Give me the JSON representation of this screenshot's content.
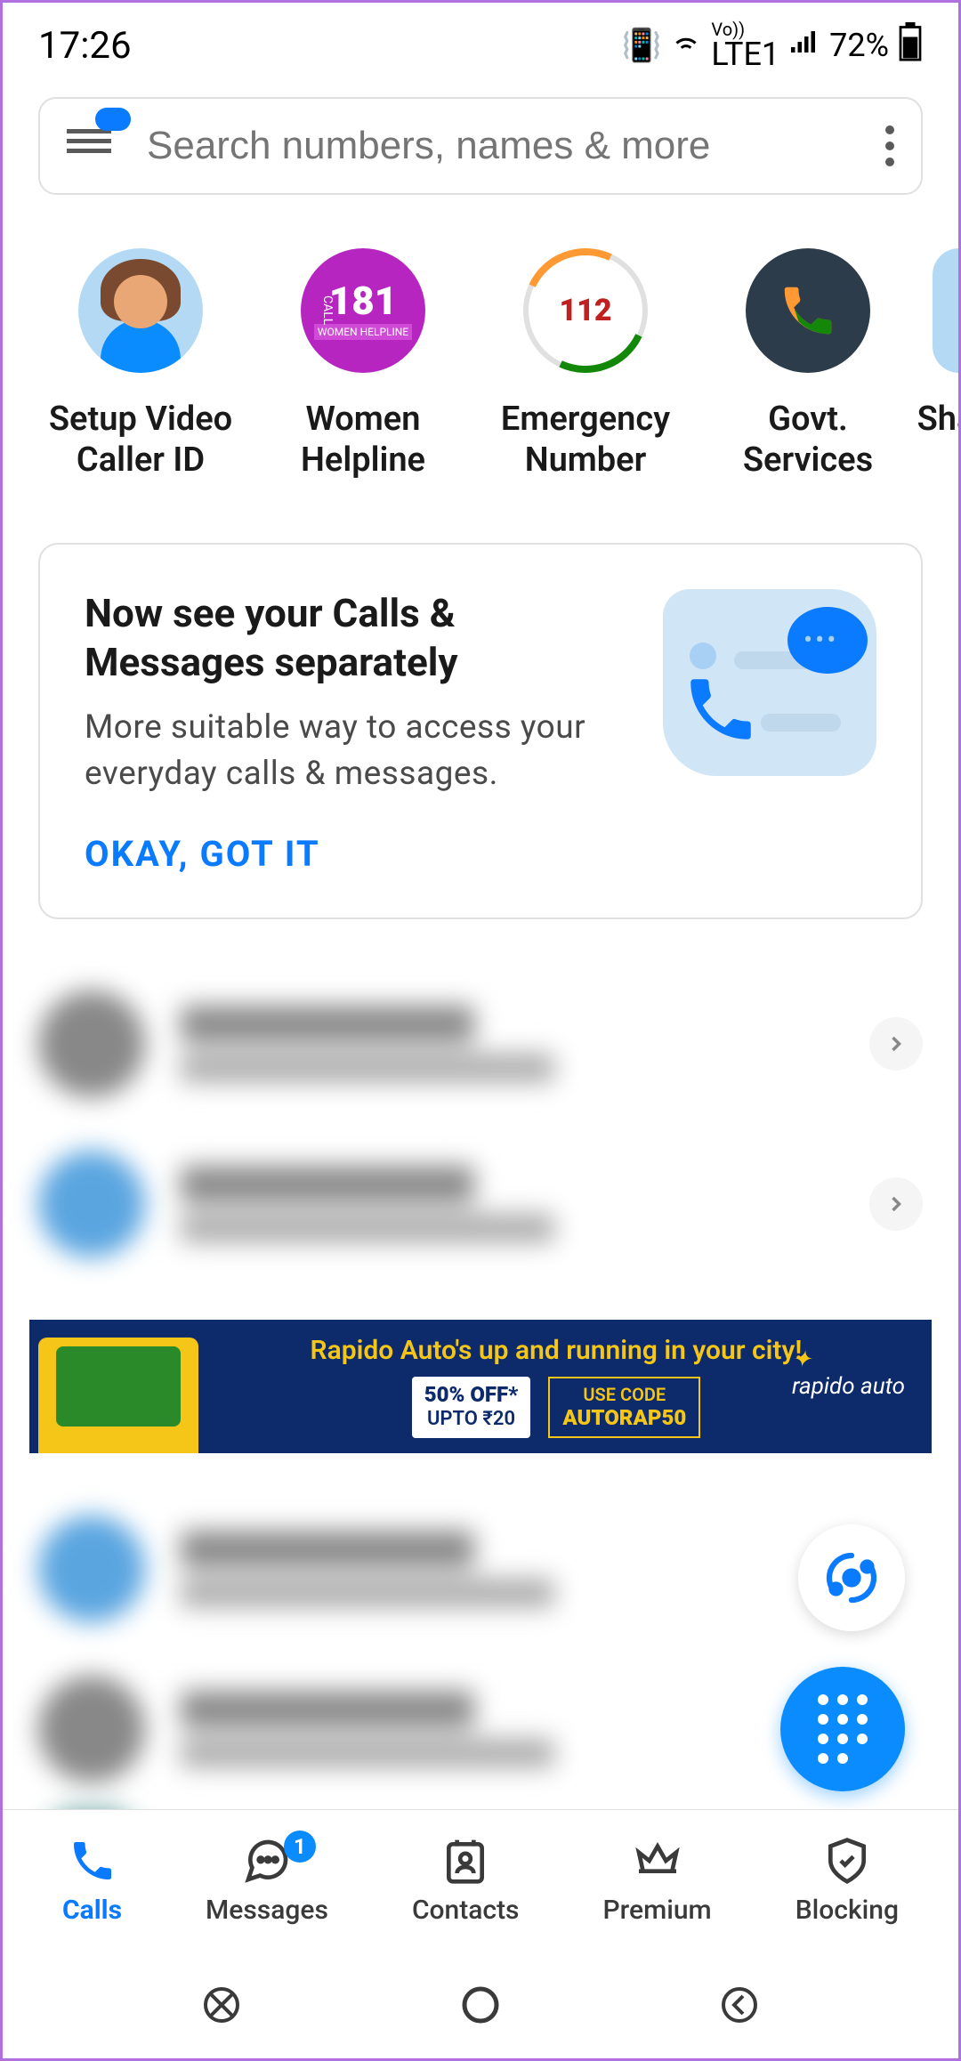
{
  "status": {
    "time": "17:26",
    "network": "LTE1",
    "battery": "72%"
  },
  "search": {
    "placeholder": "Search numbers, names & more"
  },
  "quick_actions": [
    {
      "label": "Setup Video\nCaller ID"
    },
    {
      "label": "Women\nHelpline",
      "badge_num": "181",
      "badge_sub": "WOMEN HELPLINE"
    },
    {
      "label": "Emergency\nNumber",
      "badge_num": "112"
    },
    {
      "label": "Govt.\nServices"
    },
    {
      "label": "Sha"
    }
  ],
  "info_card": {
    "title": "Now see your Calls & Messages separately",
    "desc": "More suitable way to access your everyday calls & messages.",
    "action": "OKAY, GOT IT"
  },
  "ad": {
    "title": "Rapido Auto's up and running in your city!",
    "box1_top": "50% OFF*",
    "box1_bottom": "UPTO ₹20",
    "box2_top": "USE CODE",
    "box2_code": "AUTORAP50",
    "brand": "rapido auto"
  },
  "nav": {
    "items": [
      {
        "label": "Calls",
        "active": true
      },
      {
        "label": "Messages",
        "badge": "1"
      },
      {
        "label": "Contacts"
      },
      {
        "label": "Premium"
      },
      {
        "label": "Blocking"
      }
    ]
  }
}
